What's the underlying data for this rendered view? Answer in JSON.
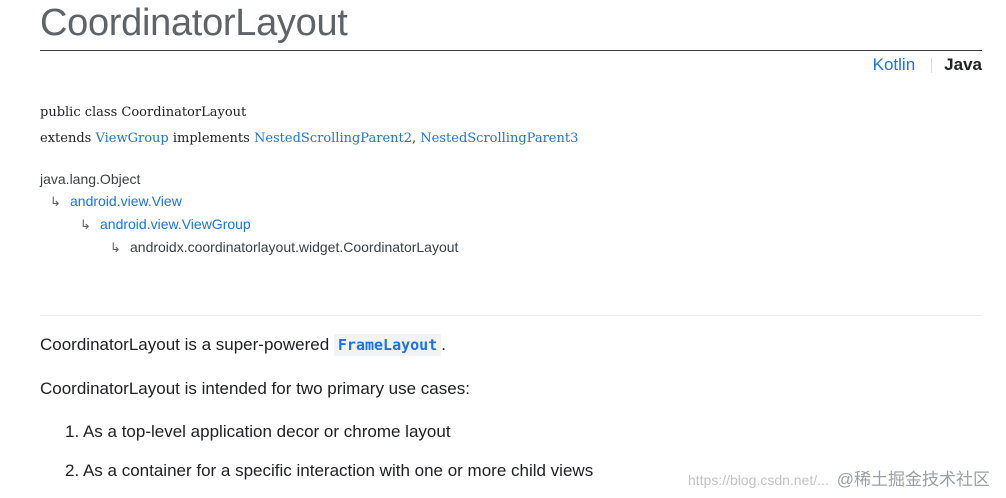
{
  "header": {
    "title": "CoordinatorLayout",
    "lang_kotlin": "Kotlin",
    "lang_java": "Java"
  },
  "signature": {
    "line1": "public class CoordinatorLayout",
    "extends_kw": "extends ",
    "parent": "ViewGroup",
    "implements_kw": " implements ",
    "iface1": "NestedScrollingParent2",
    "comma": ", ",
    "iface2": "NestedScrollingParent3"
  },
  "hierarchy": {
    "arrow": "↳",
    "items": [
      {
        "label": "java.lang.Object"
      },
      {
        "label": "android.view.View"
      },
      {
        "label": "android.view.ViewGroup"
      },
      {
        "label": "androidx.coordinatorlayout.widget.CoordinatorLayout"
      }
    ]
  },
  "description": {
    "p1_before": "CoordinatorLayout is a super-powered ",
    "p1_code": "FrameLayout",
    "p1_after": ".",
    "p2": "CoordinatorLayout is intended for two primary use cases:",
    "use_cases": [
      {
        "label": "1. As a top-level application decor or chrome layout"
      },
      {
        "label": "2. As a container for a specific interaction with one or more child views"
      }
    ]
  },
  "watermark": {
    "url": "https://blog.csdn.net/...",
    "brand": "@稀土掘金技术社区"
  },
  "colors": {
    "link": "#1a73e8",
    "text": "#202124",
    "title": "#5f6368"
  }
}
